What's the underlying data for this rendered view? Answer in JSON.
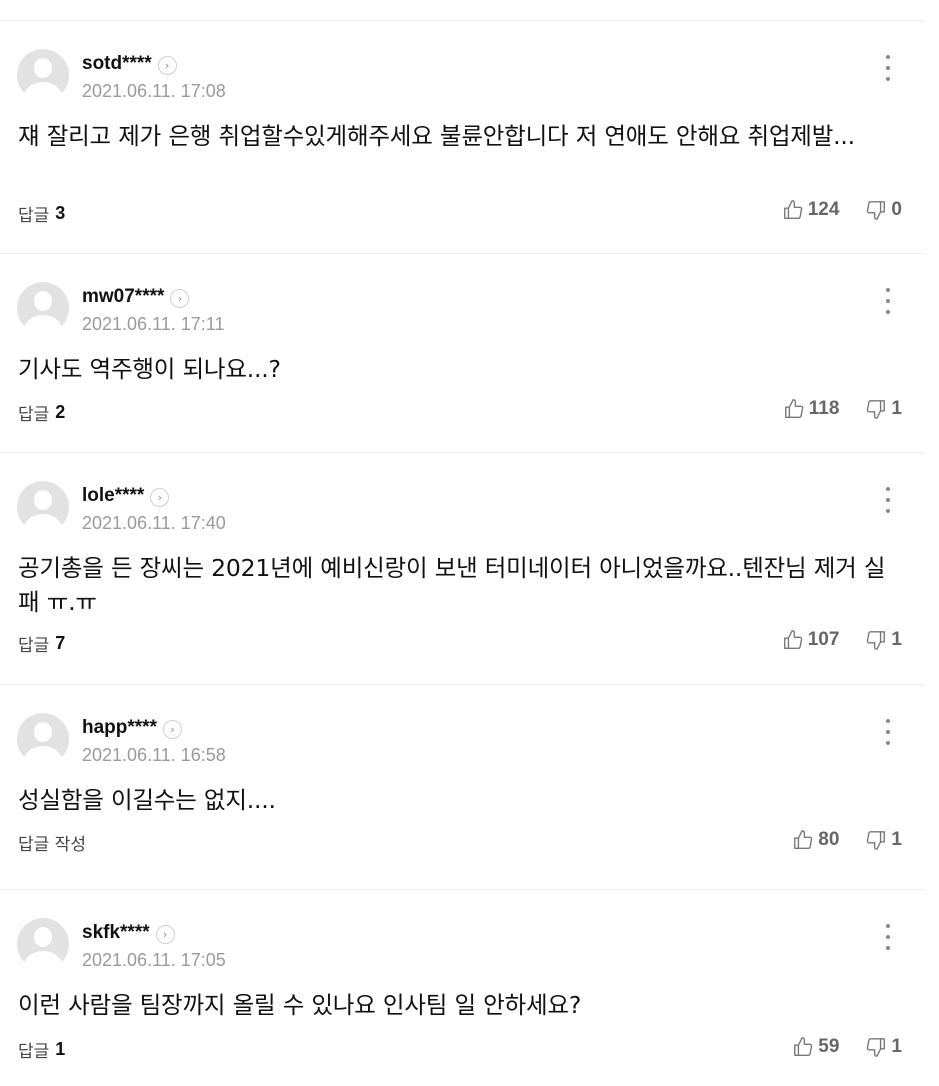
{
  "comments": [
    {
      "username": "sotd****",
      "timestamp": "2021.06.11. 17:08",
      "content": "쟤 잘리고 제가 은행 취업할수있게해주세요 불륜안합니다 저 연애도 안해요 취업제발...",
      "reply_label": "답글",
      "reply_count": "3",
      "likes": "124",
      "dislikes": "0"
    },
    {
      "username": "mw07****",
      "timestamp": "2021.06.11. 17:11",
      "content": "기사도 역주행이 되나요...?",
      "reply_label": "답글",
      "reply_count": "2",
      "likes": "118",
      "dislikes": "1"
    },
    {
      "username": "lole****",
      "timestamp": "2021.06.11. 17:40",
      "content": "공기총을 든 장씨는 2021년에 예비신랑이 보낸 터미네이터 아니었을까요..텐잔님 제거 실패 ㅠ.ㅠ",
      "reply_label": "답글",
      "reply_count": "7",
      "likes": "107",
      "dislikes": "1"
    },
    {
      "username": "happ****",
      "timestamp": "2021.06.11. 16:58",
      "content": "성실함을 이길수는 없지....",
      "reply_label": "답글 작성",
      "reply_count": "",
      "likes": "80",
      "dislikes": "1"
    },
    {
      "username": "skfk****",
      "timestamp": "2021.06.11. 17:05",
      "content": "이런 사람을 팀장까지 올릴 수 있나요 인사팀 일 안하세요?",
      "reply_label": "답글",
      "reply_count": "1",
      "likes": "59",
      "dislikes": "1"
    }
  ],
  "icons": {
    "profile_arrow": "chevron-right-icon",
    "more": "more-vertical-icon",
    "like": "thumbs-up-icon",
    "dislike": "thumbs-down-icon"
  }
}
